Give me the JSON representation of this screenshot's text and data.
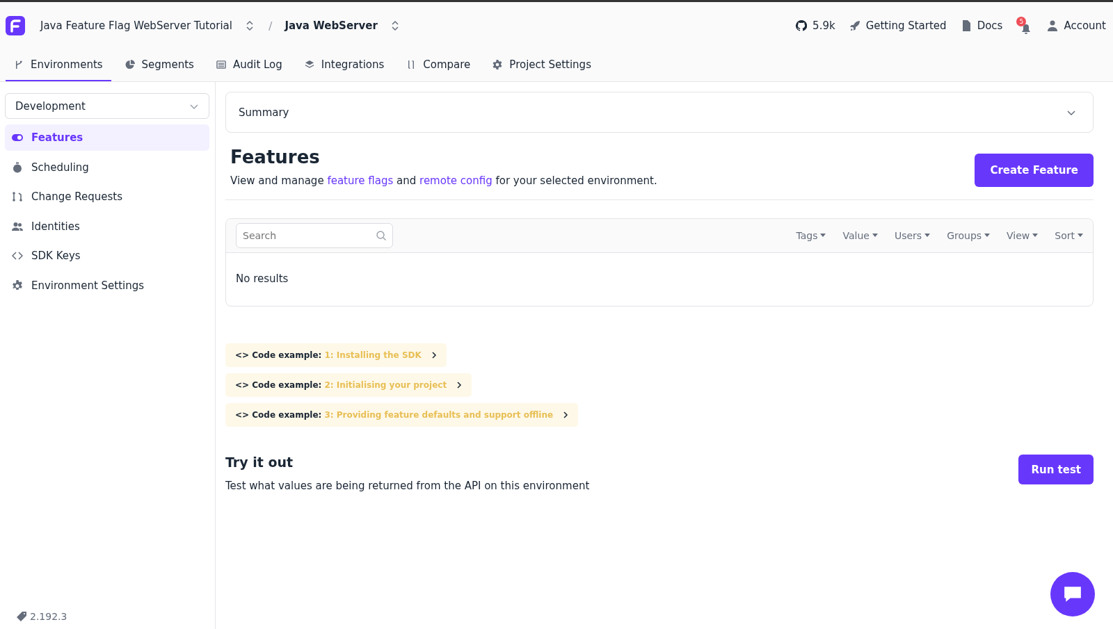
{
  "header": {
    "project": "Java Feature Flag WebServer Tutorial",
    "separator": "/",
    "environment_app": "Java WebServer",
    "links": [
      {
        "kind": "github",
        "label": "5.9k"
      },
      {
        "kind": "rocket",
        "label": "Getting Started"
      },
      {
        "kind": "doc",
        "label": "Docs"
      },
      {
        "kind": "bell",
        "badge": "5"
      },
      {
        "kind": "user",
        "label": "Account"
      }
    ]
  },
  "tabs": [
    {
      "label": "Environments",
      "selected": true
    },
    {
      "label": "Segments",
      "selected": false
    },
    {
      "label": "Audit Log",
      "selected": false
    },
    {
      "label": "Integrations",
      "selected": false
    },
    {
      "label": "Compare",
      "selected": false
    },
    {
      "label": "Project Settings",
      "selected": false
    }
  ],
  "sidebar": {
    "environment": "Development",
    "items": [
      {
        "label": "Features",
        "selected": true
      },
      {
        "label": "Scheduling",
        "selected": false
      },
      {
        "label": "Change Requests",
        "selected": false
      },
      {
        "label": "Identities",
        "selected": false
      },
      {
        "label": "SDK Keys",
        "selected": false
      },
      {
        "label": "Environment Settings",
        "selected": false
      }
    ],
    "version": "2.192.3"
  },
  "summary": {
    "title": "Summary",
    "expanded": false
  },
  "features": {
    "title": "Features",
    "description": [
      {
        "kind": "text",
        "text": "View and manage "
      },
      {
        "kind": "link",
        "text": "feature flags"
      },
      {
        "kind": "text",
        "text": " and "
      },
      {
        "kind": "link",
        "text": "remote config"
      },
      {
        "kind": "text",
        "text": " for your selected environment."
      }
    ],
    "create_button": "Create Feature"
  },
  "list": {
    "search_placeholder": "Search",
    "filters": [
      "Tags",
      "Value",
      "Users",
      "Groups",
      "View",
      "Sort"
    ],
    "empty": "No results"
  },
  "code_examples": [
    {
      "prefix": "<> Code example:",
      "title": "1: Installing the SDK"
    },
    {
      "prefix": "<> Code example:",
      "title": "2: Initialising your project"
    },
    {
      "prefix": "<> Code example:",
      "title": "3: Providing feature defaults and support offline"
    }
  ],
  "try_it": {
    "title": "Try it out",
    "description": "Test what values are being returned from the API on this environment",
    "button": "Run test"
  }
}
